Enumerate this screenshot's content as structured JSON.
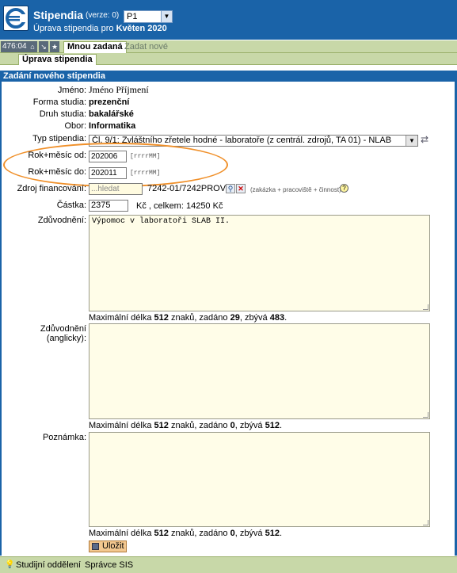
{
  "header": {
    "app_title": "Stipendia",
    "version": "(verze: 0)",
    "period": "P1",
    "subtitle_prefix": "Úprava stipendia pro ",
    "subtitle_bold": "Květen 2020"
  },
  "toolbar": {
    "counter": "476:04",
    "tab_active": "Mnou zadaná",
    "tab_new": "Zadat nové"
  },
  "subtab": "Úprava stipendia",
  "section_title": "Zadání nového stipendia",
  "form": {
    "jmeno_label": "Jméno:",
    "jmeno_value": "Jméno Příjmení",
    "forma_label": "Forma studia:",
    "forma_value": "prezenční",
    "druh_label": "Druh studia:",
    "druh_value": "bakalářské",
    "obor_label": "Obor:",
    "obor_value": "Informatika",
    "typ_label": "Typ stipendia:",
    "typ_value": "Čl. 9/1: Zvláštního zřetele hodné - laboratoře (z centrál. zdrojů, TA 01) - NLAB",
    "od_label": "Rok+měsíc od:",
    "od_value": "202006",
    "od_hint": "[rrrrMM]",
    "do_label": "Rok+měsíc do:",
    "do_value": "202011",
    "do_hint": "[rrrrMM]",
    "zdroj_label": "Zdroj financování:",
    "zdroj_placeholder": "...hledat",
    "zdroj_value": "7242-01/7242PROV",
    "zdroj_hint": "(zakázka + pracoviště + činnost)",
    "castka_label": "Částka:",
    "castka_value": "2375",
    "castka_suffix": "Kč , celkem: 14250 Kč",
    "zduv_label": "Zdůvodnění:",
    "zduv_value": "Výpomoc v laboratoři SLAB II.",
    "zduv_counter_a": "Maximální délka ",
    "zduv_counter_max": "512",
    "zduv_counter_b": " znaků, zadáno ",
    "zduv_counter_used": "29",
    "zduv_counter_c": ", zbývá ",
    "zduv_counter_left": "483",
    "zduv_counter_d": ".",
    "zduv_en_label": "Zdůvodnění (anglicky):",
    "zduv_en_counter_used": "0",
    "zduv_en_counter_left": "512",
    "pozn_label": "Poznámka:",
    "pozn_counter_used": "0",
    "pozn_counter_left": "512",
    "save_label": "Uložit"
  },
  "footer": {
    "link1": "Studijní oddělení",
    "link2": "Správce SIS"
  },
  "colors": {
    "header_blue": "#1a63a8",
    "toolbar_green": "#c8d8a8",
    "textarea_bg": "#fffde8",
    "highlight_ring": "#f0902a"
  }
}
